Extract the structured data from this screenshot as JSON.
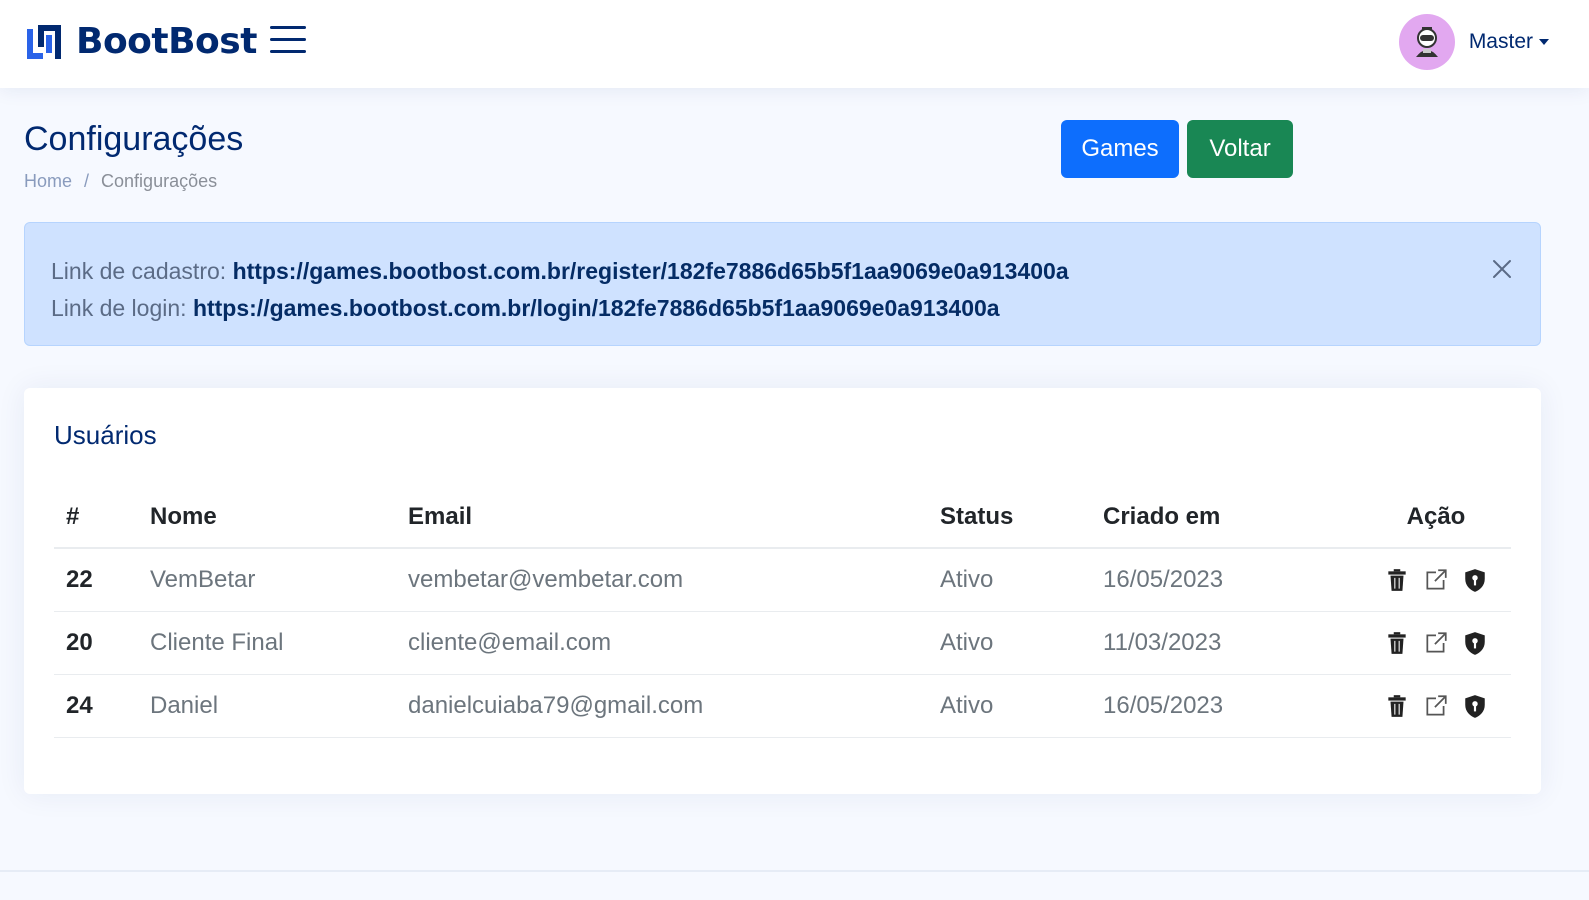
{
  "header": {
    "logo_text": "BootBost",
    "user_name": "Master"
  },
  "page": {
    "title": "Configurações",
    "breadcrumb": [
      "Home",
      "Configurações"
    ],
    "breadcrumb_sep": "/",
    "buttons": {
      "games": "Games",
      "voltar": "Voltar"
    }
  },
  "alert": {
    "register_label": "Link de cadastro: ",
    "register_link": "https://games.bootbost.com.br/register/182fe7886d65b5f1aa9069e0a913400a",
    "login_label": "Link de login: ",
    "login_link": "https://games.bootbost.com.br/login/182fe7886d65b5f1aa9069e0a913400a"
  },
  "users": {
    "title": "Usuários",
    "columns": [
      "#",
      "Nome",
      "Email",
      "Status",
      "Criado em",
      "Ação"
    ],
    "rows": [
      {
        "id": "22",
        "name": "VemBetar",
        "email": "vembetar@vembetar.com",
        "status": "Ativo",
        "created": "16/05/2023"
      },
      {
        "id": "20",
        "name": "Cliente Final",
        "email": "cliente@email.com",
        "status": "Ativo",
        "created": "11/03/2023"
      },
      {
        "id": "24",
        "name": "Daniel",
        "email": "danielcuiaba79@gmail.com",
        "status": "Ativo",
        "created": "16/05/2023"
      }
    ]
  },
  "icons": {
    "logo": "bootbost-logo-icon",
    "menu": "hamburger-menu-icon",
    "avatar": "robot-avatar-icon",
    "close": "close-icon",
    "delete": "trash-icon",
    "open": "external-link-icon",
    "permission": "shield-icon"
  },
  "colors": {
    "brand": "#012970",
    "primary": "#0d6efd",
    "success": "#198754",
    "alert_bg": "#cfe2ff",
    "page_bg": "#f6f9ff"
  }
}
